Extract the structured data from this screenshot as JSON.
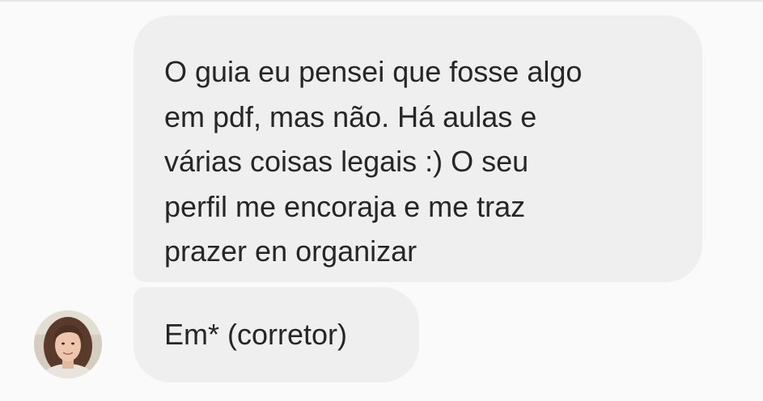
{
  "conversation": {
    "messages": [
      {
        "sender": "contact",
        "text": "O guia eu pensei que fosse algo\nem pdf, mas não. Há aulas e\nvárias coisas legais :) O seu\nperfil me encoraja e me traz\nprazer  en organizar"
      },
      {
        "sender": "contact",
        "text": "Em* (corretor)"
      }
    ],
    "avatar_icon": "person-photo-icon"
  },
  "colors": {
    "background": "#fafafa",
    "bubble": "#efefef",
    "text": "#262626"
  }
}
